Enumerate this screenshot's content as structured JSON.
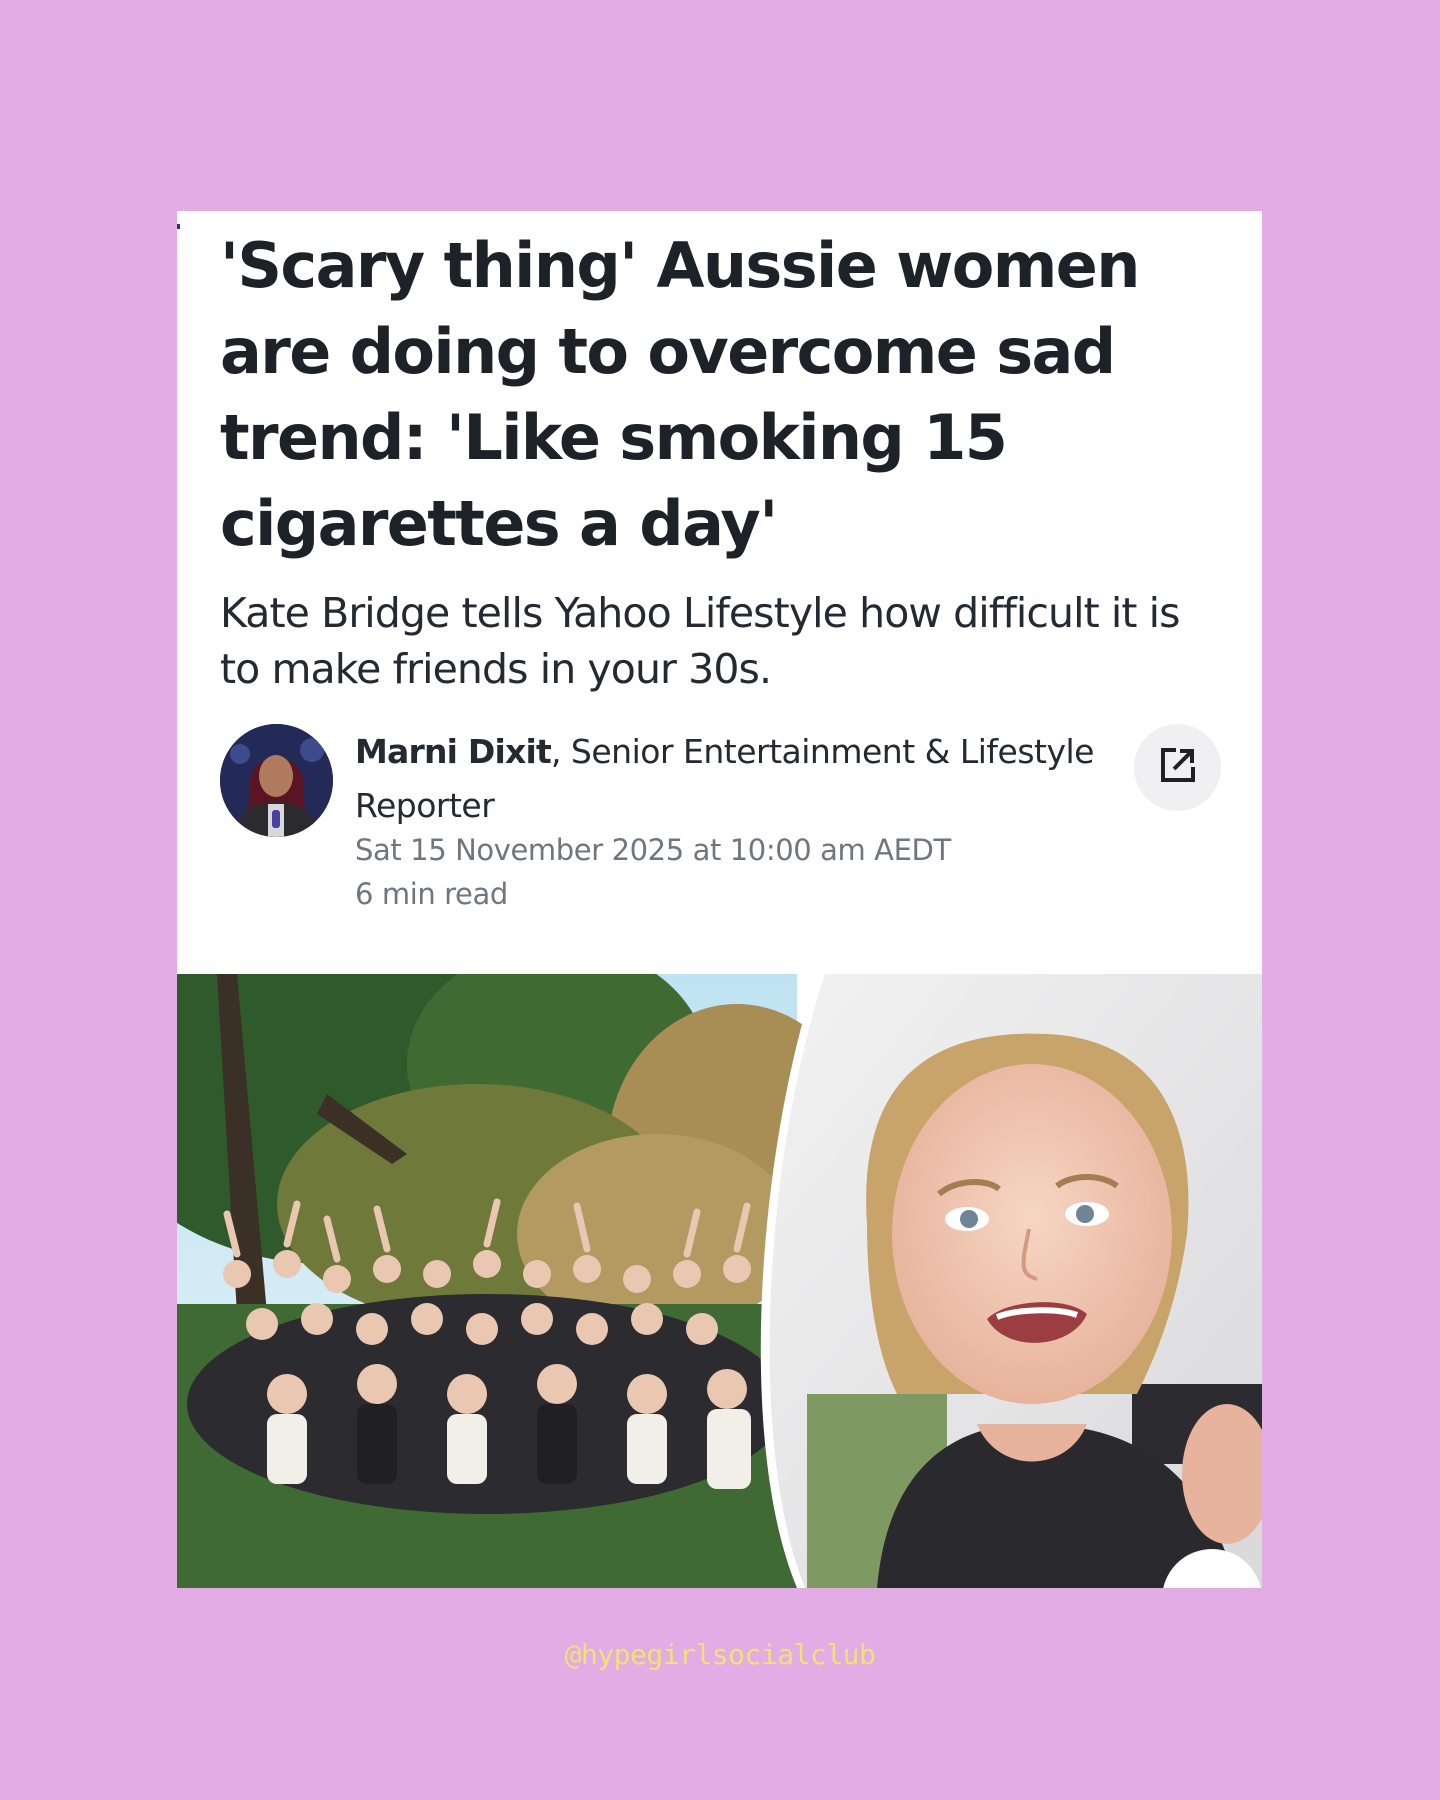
{
  "article": {
    "headline": "'Scary thing' Aussie women are doing to overcome sad trend: 'Like smoking 15 cigarettes a day'",
    "subheadline": "Kate Bridge tells Yahoo Lifestyle how difficult it is to make friends in your 30s.",
    "author_name": "Marni Dixit",
    "author_role": ", Senior Entertainment & Lifestyle Reporter",
    "date": "Sat 15 November 2025 at 10:00 am AEDT",
    "read_time": "6 min read",
    "share_icon": "external-link-icon"
  },
  "watermark": "@hypegirlsocialclub",
  "colors": {
    "page_background": "#e2ace4",
    "card_background": "#ffffff",
    "headline_text": "#1d2228",
    "meta_text": "#6e7780",
    "watermark_text": "#f4df7a"
  }
}
